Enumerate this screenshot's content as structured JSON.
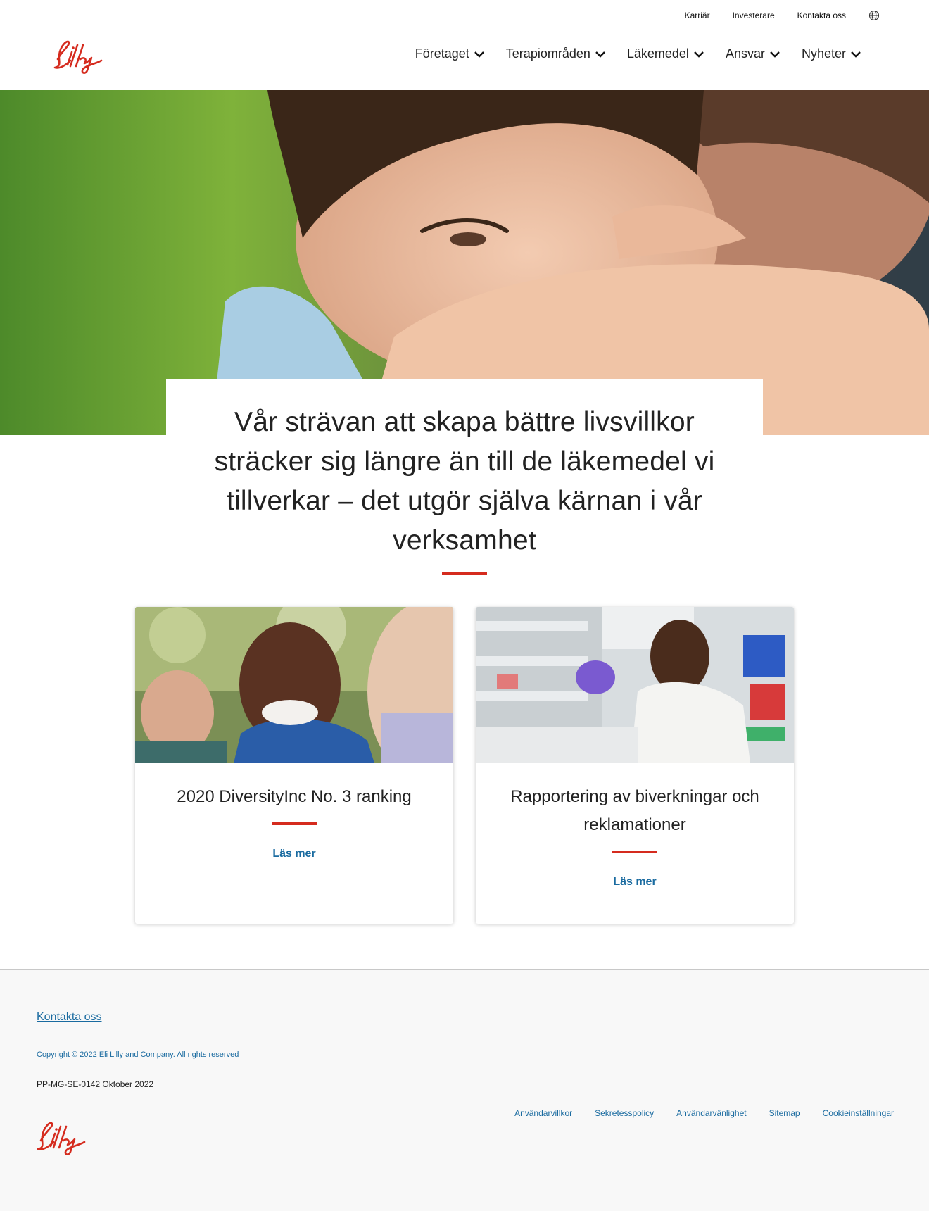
{
  "header": {
    "utility_links": [
      "Karriär",
      "Investerare",
      "Kontakta oss"
    ],
    "logo_text": "Lilly",
    "nav": [
      "Företaget",
      "Terapiområden",
      "Läkemedel",
      "Ansvar",
      "Nyheter"
    ]
  },
  "hero": {
    "quote": "Vår strävan att skapa bättre livsvillkor sträcker sig längre än till de läkemedel vi tillverkar – det utgör själva kärnan i vår verksamhet"
  },
  "cards": [
    {
      "title": "2020 DiversityInc No. 3 ranking",
      "link": "Läs mer"
    },
    {
      "title": "Rapportering av biverkningar och reklamationer",
      "link": "Läs mer"
    }
  ],
  "footer": {
    "contact": "Kontakta oss",
    "copyright": "Copyright © 2022 Eli Lilly and Company. All rights reserved",
    "code": "PP-MG-SE-0142 Oktober 2022",
    "links": [
      "Användarvillkor",
      "Sekretesspolicy",
      "Användarvänlighet",
      "Sitemap",
      "Cookieinställningar"
    ],
    "logo_text": "Lilly"
  },
  "colors": {
    "brand_red": "#d52b1e",
    "link_blue": "#1a6ba0",
    "footer_bg": "#f8f8f8"
  },
  "icons": [
    "globe-icon",
    "chevron-down-icon"
  ]
}
